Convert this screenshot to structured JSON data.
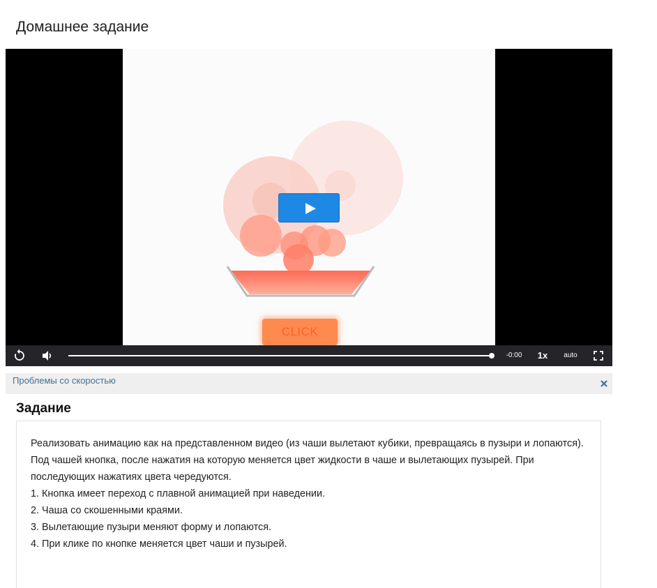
{
  "page": {
    "title": "Домашнее задание"
  },
  "video": {
    "click_button_label": "CLICK",
    "controls": {
      "time": "-0:00",
      "speed": "1x",
      "quality": "auto",
      "progress": 1.0
    },
    "icons": [
      "replay-icon",
      "volume-icon",
      "play-icon",
      "fullscreen-icon"
    ]
  },
  "speed_notice": {
    "link_text": "Проблемы со скоростью"
  },
  "task": {
    "heading": "Задание",
    "paragraphs": [
      "Реализовать анимацию как на представленном видео (из чаши вылетают кубики, превращаясь в пузыри и лопаются).",
      "Под чашей кнопка, после нажатия на которую меняется цвет жидкости в чаше и вылетающих пузырей. При последующих нажатиях цвета чередуются.",
      "1. Кнопка имеет переход с плавной анимацией при наведении.",
      "2. Чаша со скошенными краями.",
      "3. Вылетающие пузыри меняют форму и лопаются.",
      "4. При клике по кнопке меняется цвет чаши и пузырей."
    ]
  },
  "colors": {
    "accent": "#1e88e5",
    "link": "#3e6f9c",
    "bubble": "#ff7a5c",
    "button": "#ff8a50"
  }
}
